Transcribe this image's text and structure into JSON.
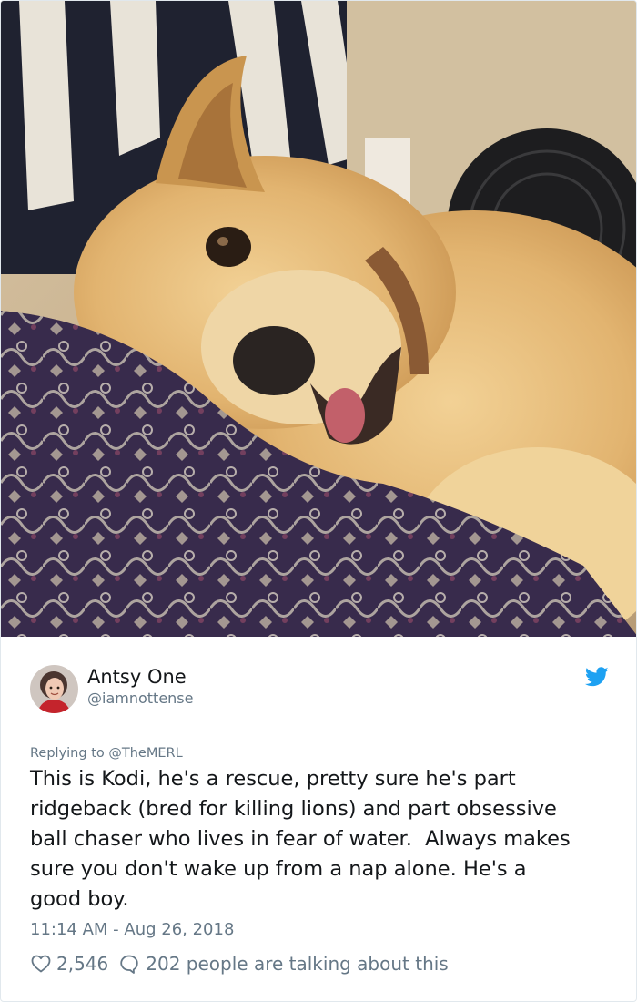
{
  "tweet": {
    "author_name": "Antsy One",
    "author_handle": "@iamnottense",
    "replying_prefix": "Replying to ",
    "replying_to": "@TheMERL",
    "text": "This is Kodi, he's a rescue, pretty sure he's part\nridgeback (bred for killing lions) and part obsessive\nball chaser who lives in fear of water.  Always makes\nsure you don't wake up from a nap alone. He's a\ngood boy.",
    "timestamp": "11:14 AM - Aug 26, 2018",
    "like_count": "2,546",
    "talking_text": "202 people are talking about this"
  },
  "icons": {
    "brand": "twitter-bird-icon",
    "like": "heart-icon",
    "reply": "speech-bubble-icon"
  },
  "colors": {
    "twitter_blue": "#1da1f2",
    "secondary_text": "#657786",
    "primary_text": "#14171a"
  }
}
